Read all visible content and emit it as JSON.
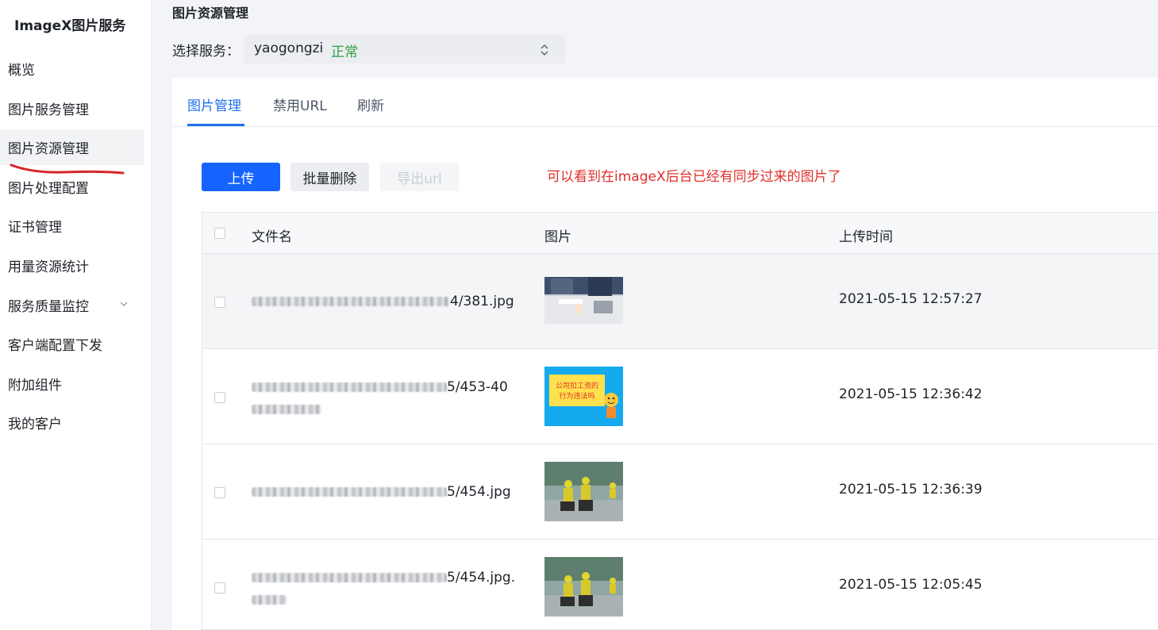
{
  "sidebar": {
    "title": "ImageX图片服务",
    "items": [
      {
        "label": "概览"
      },
      {
        "label": "图片服务管理"
      },
      {
        "label": "图片资源管理",
        "active": true
      },
      {
        "label": "图片处理配置"
      },
      {
        "label": "证书管理"
      },
      {
        "label": "用量资源统计"
      },
      {
        "label": "服务质量监控",
        "expandable": true
      },
      {
        "label": "客户端配置下发"
      },
      {
        "label": "附加组件"
      },
      {
        "label": "我的客户"
      }
    ]
  },
  "header": {
    "title": "图片资源管理",
    "service_label": "选择服务：",
    "service_name": "yaogongzi",
    "service_status": "正常"
  },
  "tabs": [
    {
      "label": "图片管理",
      "active": true
    },
    {
      "label": "禁用URL"
    },
    {
      "label": "刷新"
    }
  ],
  "toolbar": {
    "upload_label": "上传",
    "batch_delete_label": "批量删除",
    "export_label": "导出url"
  },
  "annotation": "可以看到在imageX后台已经有同步过来的图片了",
  "table": {
    "columns": [
      "文件名",
      "图片",
      "上传时间"
    ],
    "rows": [
      {
        "file_line1": "4/381.jpg",
        "file_line2": "",
        "time": "2021-05-15 12:57:27"
      },
      {
        "file_line1": "5/453-40",
        "file_line2": "",
        "time": "2021-05-15 12:36:42"
      },
      {
        "file_line1": "5/454.jpg",
        "file_line2": "",
        "time": "2021-05-15 12:36:39"
      },
      {
        "file_line1": "5/454.jpg.",
        "file_line2": "",
        "time": "2021-05-15 12:05:45"
      }
    ]
  },
  "thumb_texts": {
    "line1": "公司扣工资的",
    "line2": "行为违法吗"
  },
  "colors": {
    "primary": "#1664ff",
    "status_ok": "#2ea043",
    "annotation": "#e0302b"
  }
}
